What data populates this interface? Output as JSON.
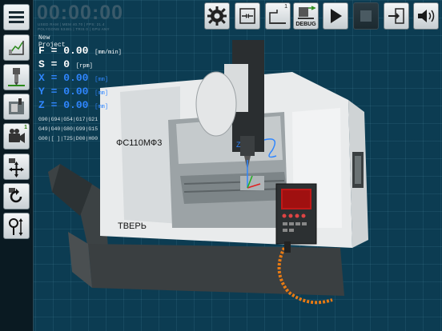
{
  "header": {
    "timer": "00:00:00",
    "status_line1": "USED RAM | MEM 40.70 | FPS: 21.4",
    "status_line2": "POLYGONS 53481 | TRIS 0 | GPU ANY"
  },
  "info": {
    "project_name": "New Project",
    "feed": {
      "label": "F = ",
      "value": "0.00",
      "unit": "[mm/min]"
    },
    "speed": {
      "label": "S = ",
      "value": "0",
      "unit": "[rpm]"
    },
    "x": {
      "label": "X = ",
      "value": "0.00",
      "unit": "[mm]"
    },
    "y": {
      "label": "Y = ",
      "value": "0.00",
      "unit": "[mm]"
    },
    "z": {
      "label": "Z = ",
      "value": "0.00",
      "unit": "[mm]"
    },
    "gcode_line1": "G90|G94|G54|G17|G21",
    "gcode_line2": "G49|G40|G80|G99|G15",
    "gcode_line3": "G00|[ ]|T25|D00|H00"
  },
  "toolbar": {
    "debug_label": "DEBUG",
    "tool_badge": "1",
    "sidebar_badge": "1"
  },
  "machine": {
    "model_label": "ФС110МФ3",
    "brand_label": "ТВЕРЬ"
  },
  "icons": {
    "menu": "menu-icon",
    "settings": "gear-icon",
    "play": "play-icon",
    "stop": "stop-icon",
    "sound": "speaker-icon"
  },
  "colors": {
    "background": "#0c3c52",
    "axis_blue": "#2f86ff",
    "hose_orange": "#e77a14"
  }
}
